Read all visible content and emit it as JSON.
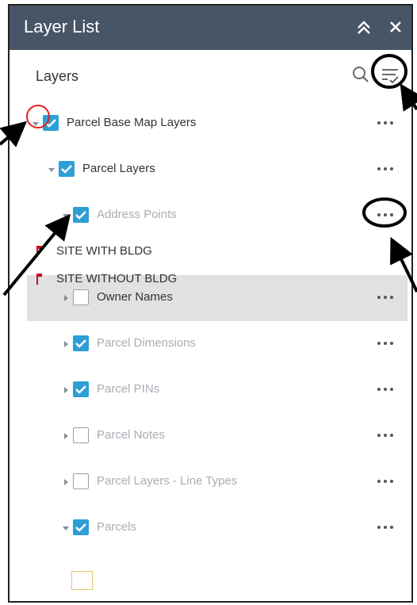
{
  "header": {
    "title": "Layer List"
  },
  "section": {
    "title": "Layers"
  },
  "layers": [
    {
      "label": "Parcel Base Map Layers",
      "checked": true,
      "expanded": true
    },
    {
      "label": "Parcel Layers",
      "checked": true,
      "expanded": true
    },
    {
      "label": "Address Points",
      "checked": true,
      "expanded": true
    },
    {
      "label": "Owner Names",
      "checked": false,
      "expanded": false
    },
    {
      "label": "Parcel Dimensions",
      "checked": true,
      "expanded": false
    },
    {
      "label": "Parcel PINs",
      "checked": true,
      "expanded": false
    },
    {
      "label": "Parcel Notes",
      "checked": false,
      "expanded": false
    },
    {
      "label": "Parcel Layers - Line Types",
      "checked": false,
      "expanded": false
    },
    {
      "label": "Parcels",
      "checked": true,
      "expanded": true
    }
  ],
  "legend": [
    {
      "label": "SITE WITH BLDG"
    },
    {
      "label": "SITE WITHOUT BLDG"
    }
  ],
  "colors": {
    "header_bg": "#485566",
    "checkbox_on": "#2e9fd6",
    "highlight_row": "#dfe1e3",
    "legend_flag": "#d0021b",
    "parcel_symbol_border": "#e9c46a",
    "annotation_circle_red": "#e02020"
  },
  "icons": [
    "collapse-icon",
    "close-icon",
    "search-icon",
    "filter-options-icon",
    "more-options-icon",
    "caret-down-icon",
    "caret-right-icon",
    "checkbox-icon",
    "flag-icon"
  ]
}
